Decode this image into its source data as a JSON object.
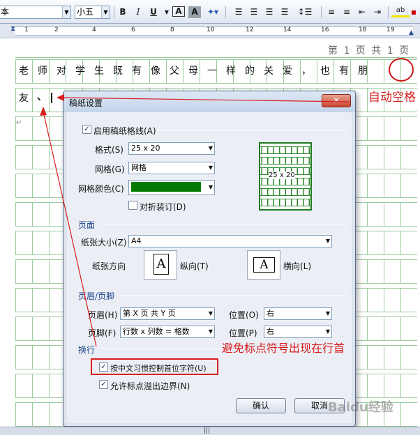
{
  "toolbar": {
    "font_name": "本",
    "font_size": "小五",
    "bold": "B",
    "italic": "I",
    "underline": "U",
    "char_border": "A",
    "char_shading": "A",
    "format_icon_label": "ab"
  },
  "ruler": {
    "numbers": [
      "1",
      "2",
      "4",
      "6",
      "8",
      "10",
      "12",
      "14",
      "16",
      "18",
      "19"
    ]
  },
  "document": {
    "header_text": "第 1 页 共 1 页",
    "line1": [
      "老",
      "师",
      "对",
      "学",
      "生",
      "既",
      "有",
      "像",
      "父",
      "母",
      "一",
      "样",
      "的",
      "关",
      "爱",
      "，",
      "也",
      "有",
      "朋"
    ],
    "line2_char1": "友",
    "line2_char2": "、",
    "para_mark": "↵"
  },
  "annotations": {
    "auto_space": "自动空格",
    "avoid_punct": "避免标点符号出现在行首"
  },
  "dialog": {
    "title": "稿纸设置",
    "close_label": "✕",
    "enable_grid_label": "启用稿纸格线(A)",
    "format_label": "格式(S)",
    "format_value": "25 x 20",
    "grid_label": "网格(G)",
    "grid_value": "网格",
    "grid_color_label": "网格颜色(C)",
    "grid_color": "#007a00",
    "fold_binding_label": "对折装订(D)",
    "preview_label": "25 x 20",
    "page_section": "页面",
    "paper_size_label": "纸张大小(Z)",
    "paper_size_value": "A4",
    "orientation_label": "纸张方向",
    "portrait_label": "纵向(T)",
    "landscape_label": "横向(L)",
    "orientation_glyph": "A",
    "header_footer_section": "页眉/页脚",
    "header_label": "页眉(H)",
    "header_value": "第 X 页 共 Y 页",
    "header_pos_label": "位置(O)",
    "header_pos_value": "右",
    "footer_label": "页脚(F)",
    "footer_value": "行数 x 列数 = 格数",
    "footer_pos_label": "位置(P)",
    "footer_pos_value": "右",
    "linebreak_section": "换行",
    "cjk_rule_label": "按中文习惯控制首位字符(U)",
    "allow_overflow_label": "允许标点溢出边界(N)",
    "ok_label": "确认",
    "cancel_label": "取消"
  },
  "watermark": "Baidu经验",
  "colors": {
    "grid_green": "#9ccc9c",
    "annotation_red": "#d81e1e",
    "section_blue": "#1c3f8a"
  }
}
